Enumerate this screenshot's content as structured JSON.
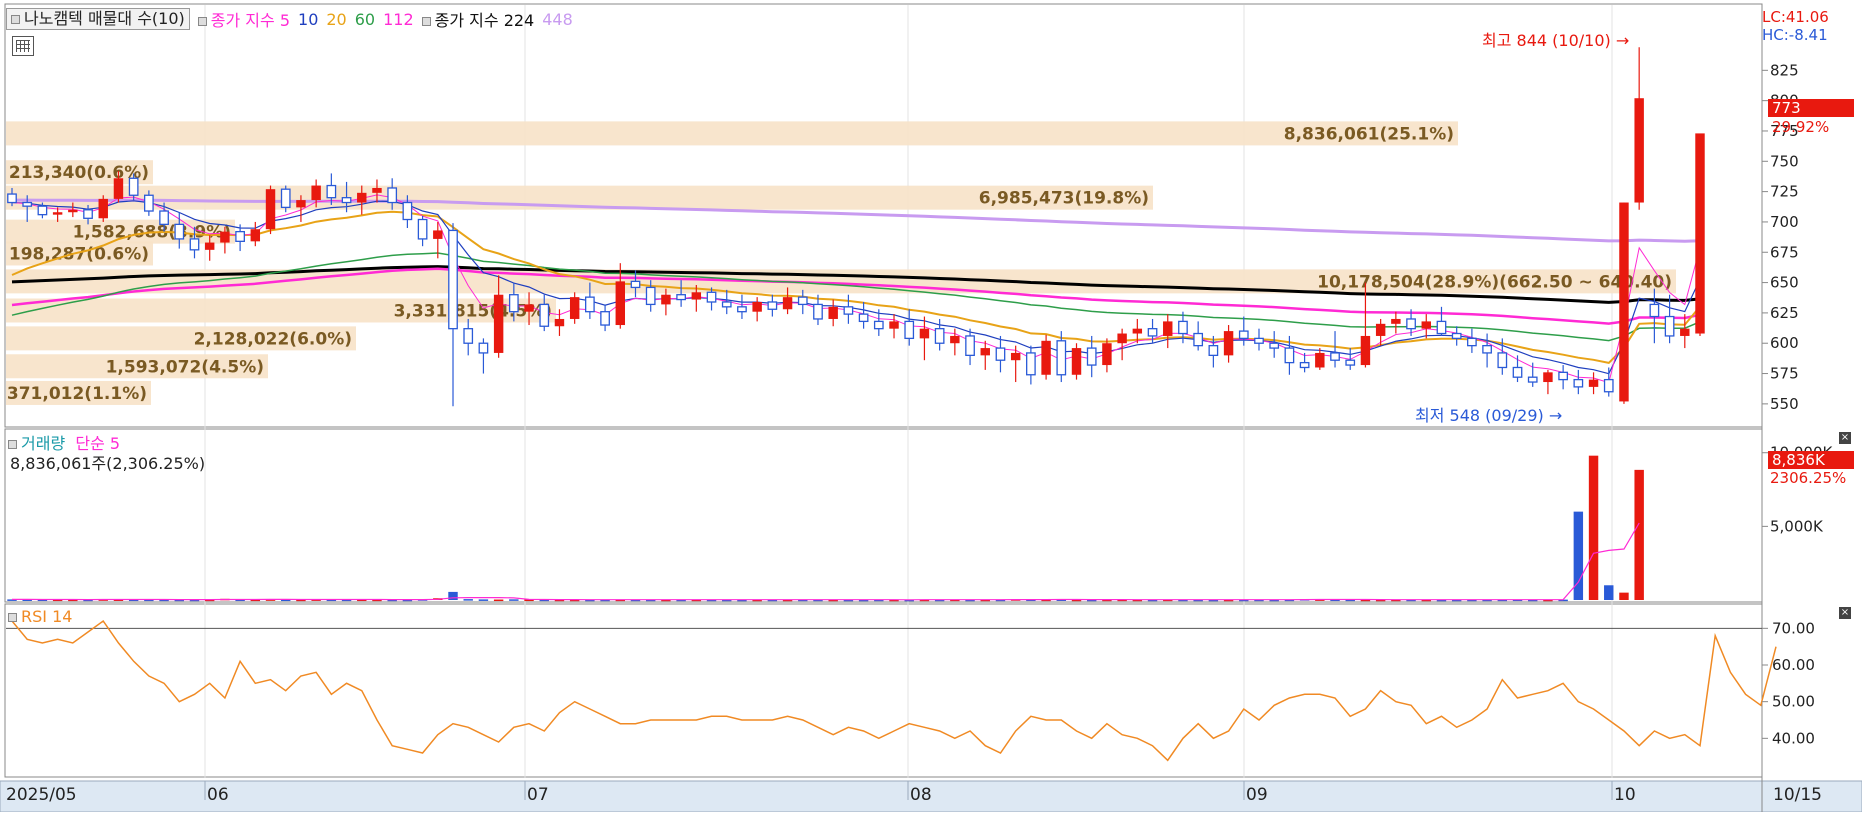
{
  "price_panel": {
    "stock_name": "나노캠텍 매물대 수(10)",
    "ma_label": "종가 지수 5",
    "ma_periods": [
      "10",
      "20",
      "60",
      "112"
    ],
    "ma_colors": [
      "#1f3fbf",
      "#e8a317",
      "#2e9e4a",
      "#ff2ad4"
    ],
    "long_ma_label": "종가 지수 224",
    "long_ma_extra": "448",
    "lc": "LC:41.06",
    "hc": "HC:-8.41",
    "price_badge": "773",
    "change_badge": "29.92%",
    "high_note": "최고 844 (10/10) →",
    "low_note": "최저 548 (09/29) →",
    "y_ticks": [
      "825",
      "800",
      "775",
      "750",
      "725",
      "700",
      "675",
      "650",
      "625",
      "600",
      "575",
      "550"
    ]
  },
  "volume_profile": [
    {
      "label": "8,836,061(25.1%)",
      "price": 773
    },
    {
      "label": "6,985,473(19.8%)",
      "price": 720
    },
    {
      "label": "10,178,504(28.9%)(662.50 ~ 640.40)",
      "price": 651
    },
    {
      "label": "213,340(0.6%)",
      "price": 741
    },
    {
      "label": "1,582,688(3.9%)",
      "price": 692
    },
    {
      "label": "198,287(0.6%)",
      "price": 674
    },
    {
      "label": "3,331,815(4.5%)",
      "price": 627
    },
    {
      "label": "2,128,022(6.0%)",
      "price": 604
    },
    {
      "label": "1,593,072(4.5%)",
      "price": 581
    },
    {
      "label": "371,012(1.1%)",
      "price": 559
    }
  ],
  "volume_panel": {
    "title": "거래량",
    "ma_label": "단순 5",
    "summary": "8,836,061주(2,306.25%)",
    "y_ticks": [
      "10,000K",
      "5,000K"
    ],
    "badge_value": "8,836K",
    "badge_pct": "2306.25%"
  },
  "rsi_panel": {
    "title": "RSI 14",
    "y_ticks": [
      "70.00",
      "60.00",
      "50.00",
      "40.00"
    ]
  },
  "x_axis": {
    "labels": [
      "2025/05",
      "06",
      "07",
      "08",
      "09",
      "10"
    ],
    "last_date": "10/15"
  },
  "colors": {
    "up": "#e8190f",
    "down": "#2a5ad7",
    "ma224": "#000000",
    "ma448": "#c89bf0",
    "rsi": "#f08a24",
    "profile": "#f7e2c8"
  },
  "chart_data": [
    {
      "type": "candlestick",
      "title": "나노캠텍 매물대 수(10)",
      "ylim": [
        540,
        850
      ],
      "high": {
        "value": 844,
        "date": "10/10"
      },
      "low": {
        "value": 548,
        "date": "09/29"
      },
      "last_close": 773,
      "last_change_pct": 29.92,
      "ohlc": [
        [
          723,
          728,
          713,
          716
        ],
        [
          716,
          722,
          700,
          713
        ],
        [
          713,
          716,
          703,
          706
        ],
        [
          706,
          712,
          700,
          708
        ],
        [
          708,
          716,
          704,
          710
        ],
        [
          710,
          714,
          698,
          703
        ],
        [
          703,
          722,
          700,
          719
        ],
        [
          719,
          742,
          716,
          736
        ],
        [
          736,
          740,
          718,
          722
        ],
        [
          722,
          726,
          705,
          709
        ],
        [
          709,
          716,
          692,
          698
        ],
        [
          698,
          708,
          678,
          686
        ],
        [
          686,
          696,
          670,
          677
        ],
        [
          677,
          689,
          668,
          683
        ],
        [
          683,
          696,
          674,
          692
        ],
        [
          692,
          698,
          676,
          684
        ],
        [
          684,
          700,
          680,
          694
        ],
        [
          694,
          730,
          690,
          727
        ],
        [
          727,
          730,
          708,
          712
        ],
        [
          712,
          722,
          700,
          718
        ],
        [
          718,
          735,
          712,
          730
        ],
        [
          730,
          740,
          714,
          720
        ],
        [
          720,
          733,
          708,
          716
        ],
        [
          716,
          730,
          706,
          724
        ],
        [
          724,
          735,
          716,
          728
        ],
        [
          728,
          736,
          710,
          716
        ],
        [
          716,
          722,
          695,
          702
        ],
        [
          702,
          705,
          680,
          686
        ],
        [
          686,
          700,
          670,
          693
        ],
        [
          693,
          699,
          548,
          612
        ],
        [
          612,
          620,
          590,
          600
        ],
        [
          600,
          604,
          575,
          592
        ],
        [
          592,
          656,
          588,
          640
        ],
        [
          640,
          650,
          618,
          626
        ],
        [
          626,
          642,
          615,
          632
        ],
        [
          632,
          640,
          610,
          614
        ],
        [
          614,
          628,
          606,
          620
        ],
        [
          620,
          642,
          616,
          638
        ],
        [
          638,
          650,
          620,
          626
        ],
        [
          626,
          632,
          610,
          615
        ],
        [
          615,
          666,
          612,
          651
        ],
        [
          651,
          660,
          638,
          646
        ],
        [
          646,
          652,
          626,
          632
        ],
        [
          632,
          645,
          623,
          640
        ],
        [
          640,
          652,
          630,
          636
        ],
        [
          636,
          648,
          626,
          642
        ],
        [
          642,
          646,
          627,
          634
        ],
        [
          634,
          644,
          624,
          630
        ],
        [
          630,
          640,
          620,
          626
        ],
        [
          626,
          638,
          618,
          634
        ],
        [
          634,
          640,
          622,
          628
        ],
        [
          628,
          646,
          624,
          638
        ],
        [
          638,
          644,
          624,
          632
        ],
        [
          632,
          640,
          615,
          620
        ],
        [
          620,
          636,
          614,
          630
        ],
        [
          630,
          640,
          616,
          624
        ],
        [
          624,
          634,
          612,
          618
        ],
        [
          618,
          628,
          606,
          612
        ],
        [
          612,
          624,
          604,
          618
        ],
        [
          618,
          628,
          598,
          604
        ],
        [
          604,
          622,
          586,
          612
        ],
        [
          612,
          620,
          594,
          600
        ],
        [
          600,
          612,
          590,
          606
        ],
        [
          606,
          612,
          582,
          590
        ],
        [
          590,
          602,
          578,
          596
        ],
        [
          596,
          606,
          576,
          586
        ],
        [
          586,
          598,
          568,
          592
        ],
        [
          592,
          598,
          566,
          574
        ],
        [
          574,
          607,
          570,
          602
        ],
        [
          602,
          610,
          568,
          574
        ],
        [
          574,
          600,
          570,
          596
        ],
        [
          596,
          606,
          572,
          582
        ],
        [
          582,
          604,
          576,
          600
        ],
        [
          600,
          612,
          586,
          608
        ],
        [
          608,
          620,
          600,
          612
        ],
        [
          612,
          620,
          600,
          606
        ],
        [
          606,
          624,
          596,
          618
        ],
        [
          618,
          626,
          600,
          608
        ],
        [
          608,
          618,
          594,
          598
        ],
        [
          598,
          606,
          580,
          590
        ],
        [
          590,
          615,
          584,
          610
        ],
        [
          610,
          622,
          598,
          604
        ],
        [
          604,
          612,
          594,
          600
        ],
        [
          600,
          610,
          588,
          596
        ],
        [
          596,
          606,
          574,
          584
        ],
        [
          584,
          592,
          576,
          580
        ],
        [
          580,
          596,
          578,
          592
        ],
        [
          592,
          610,
          580,
          586
        ],
        [
          586,
          596,
          578,
          582
        ],
        [
          582,
          650,
          580,
          606
        ],
        [
          606,
          620,
          598,
          616
        ],
        [
          616,
          626,
          608,
          620
        ],
        [
          620,
          628,
          606,
          612
        ],
        [
          612,
          624,
          604,
          618
        ],
        [
          618,
          630,
          606,
          608
        ],
        [
          608,
          614,
          598,
          604
        ],
        [
          604,
          612,
          592,
          598
        ],
        [
          598,
          608,
          580,
          592
        ],
        [
          592,
          604,
          574,
          580
        ],
        [
          580,
          590,
          568,
          572
        ],
        [
          572,
          584,
          564,
          568
        ],
        [
          568,
          578,
          558,
          576
        ],
        [
          576,
          582,
          562,
          570
        ],
        [
          570,
          578,
          558,
          564
        ],
        [
          564,
          576,
          558,
          570
        ],
        [
          570,
          580,
          556,
          560
        ],
        [
          552,
          716,
          550,
          716
        ],
        [
          716,
          844,
          710,
          802
        ],
        [
          632,
          645,
          600,
          622
        ],
        [
          622,
          640,
          600,
          606
        ],
        [
          606,
          624,
          596,
          612
        ],
        [
          608,
          770,
          606,
          773
        ]
      ]
    },
    {
      "type": "bar",
      "title": "거래량",
      "ylim": [
        0,
        11000
      ],
      "values": [
        40,
        35,
        32,
        30,
        28,
        25,
        45,
        35,
        30,
        28,
        25,
        22,
        20,
        25,
        80,
        30,
        28,
        45,
        30,
        25,
        40,
        30,
        28,
        30,
        25,
        22,
        20,
        50,
        120,
        550,
        60,
        40,
        30,
        45,
        30,
        25,
        22,
        20,
        18,
        20,
        25,
        22,
        20,
        18,
        20,
        22,
        20,
        18,
        15,
        18,
        20,
        18,
        22,
        20,
        18,
        15,
        15,
        20,
        18,
        15,
        22,
        20,
        25,
        18,
        20,
        22,
        50,
        30,
        25,
        35,
        20,
        18,
        22,
        25,
        20,
        18,
        25,
        20,
        18,
        15,
        18,
        20,
        22,
        18,
        25,
        60,
        40,
        30,
        25,
        20,
        18,
        20,
        22,
        18,
        15,
        18,
        20,
        22,
        25,
        30,
        20,
        18,
        25,
        6000,
        9800,
        1000,
        500,
        8836
      ]
    },
    {
      "type": "line",
      "title": "RSI 14",
      "ylim": [
        30,
        75
      ],
      "values": [
        72,
        67,
        66,
        67,
        66,
        69,
        72,
        66,
        61,
        57,
        55,
        50,
        52,
        55,
        51,
        61,
        55,
        56,
        53,
        57,
        58,
        52,
        55,
        53,
        45,
        38,
        37,
        36,
        41,
        44,
        43,
        41,
        39,
        43,
        44,
        42,
        47,
        50,
        48,
        46,
        44,
        44,
        45,
        45,
        45,
        45,
        46,
        46,
        45,
        45,
        45,
        46,
        45,
        43,
        41,
        43,
        42,
        40,
        42,
        44,
        43,
        42,
        40,
        42,
        38,
        36,
        42,
        46,
        45,
        45,
        42,
        40,
        44,
        41,
        40,
        38,
        34,
        40,
        44,
        40,
        42,
        48,
        45,
        49,
        51,
        52,
        52,
        51,
        46,
        48,
        53,
        50,
        49,
        44,
        46,
        43,
        45,
        48,
        56,
        51,
        52,
        53,
        55,
        50,
        48,
        45,
        42,
        38,
        42,
        40,
        41,
        38,
        68,
        58,
        52,
        49,
        65
      ]
    }
  ]
}
